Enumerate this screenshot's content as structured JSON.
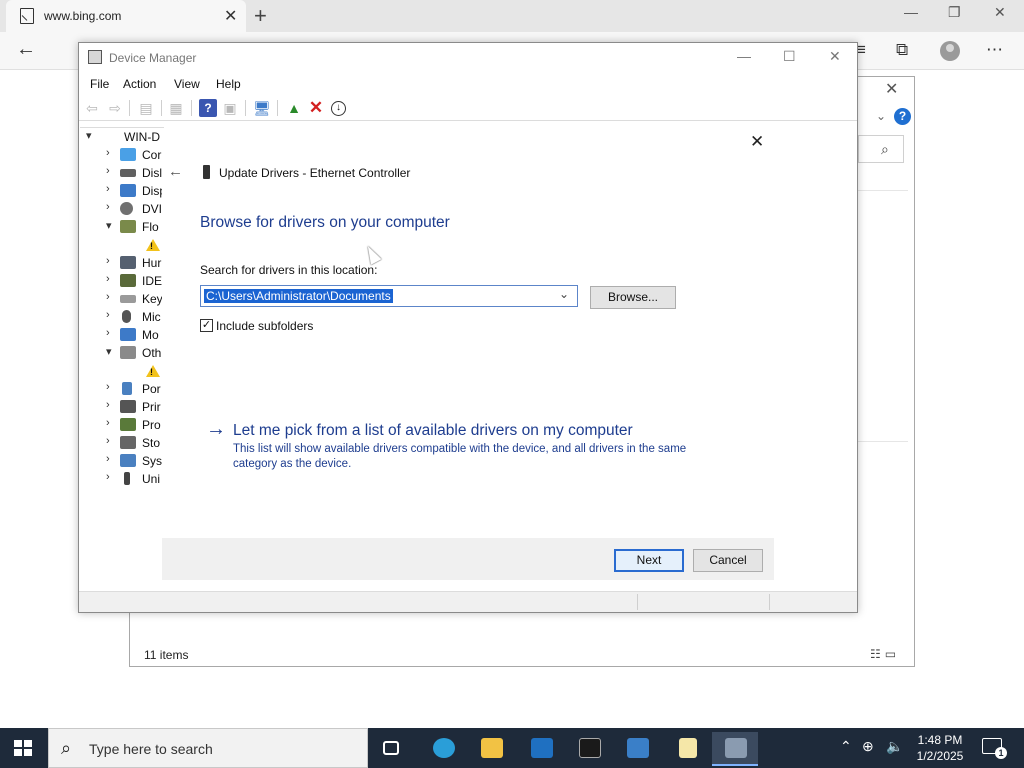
{
  "browser": {
    "tab_title": "www.bing.com",
    "tab_close": "✕",
    "new_tab": "+",
    "minimize": "—",
    "restore": "❐",
    "close": "✕",
    "back": "←",
    "more": "⋯"
  },
  "explorer_bg": {
    "close": "✕",
    "help": "?",
    "item_count": "11 items"
  },
  "device_manager": {
    "title": "Device Manager",
    "menu": [
      "File",
      "Action",
      "View",
      "Help"
    ],
    "tree": [
      {
        "label": "WIN-D",
        "expander": "▾",
        "icon": "computer-icon",
        "color": "#6b7f95"
      },
      {
        "label": "Cor",
        "expander": "›",
        "icon": "computer-icon",
        "color": "#4aa0e6"
      },
      {
        "label": "Disl",
        "expander": "›",
        "icon": "disk-drive-icon",
        "color": "#606060"
      },
      {
        "label": "Disp",
        "expander": "›",
        "icon": "display-adapter-icon",
        "color": "#3d7ac8"
      },
      {
        "label": "DVI",
        "expander": "›",
        "icon": "dvd-drive-icon",
        "color": "#707070"
      },
      {
        "label": "Flo",
        "expander": "▾",
        "icon": "floppy-controller-icon",
        "color": "#7a8a4a"
      },
      {
        "label": "Hur",
        "expander": "›",
        "icon": "hid-icon",
        "color": "#556070"
      },
      {
        "label": "IDE",
        "expander": "›",
        "icon": "ide-controller-icon",
        "color": "#5a6a3a"
      },
      {
        "label": "Key",
        "expander": "›",
        "icon": "keyboard-icon",
        "color": "#7a7a7a"
      },
      {
        "label": "Mic",
        "expander": "›",
        "icon": "mouse-icon",
        "color": "#555555"
      },
      {
        "label": "Mo",
        "expander": "›",
        "icon": "monitor-icon",
        "color": "#3d7ac8"
      },
      {
        "label": "Oth",
        "expander": "▾",
        "icon": "other-devices-icon",
        "color": "#8a8a8a"
      },
      {
        "label": "Por",
        "expander": "›",
        "icon": "ports-icon",
        "color": "#4a80c0"
      },
      {
        "label": "Prir",
        "expander": "›",
        "icon": "print-queue-icon",
        "color": "#555555"
      },
      {
        "label": "Pro",
        "expander": "›",
        "icon": "processor-icon",
        "color": "#5a7a3a"
      },
      {
        "label": "Sto",
        "expander": "›",
        "icon": "storage-controller-icon",
        "color": "#666666"
      },
      {
        "label": "Syst",
        "expander": "›",
        "icon": "system-devices-icon",
        "color": "#4a80c0"
      },
      {
        "label": "Uni",
        "expander": "›",
        "icon": "usb-icon",
        "color": "#444444"
      }
    ]
  },
  "wizard": {
    "close": "✕",
    "back": "←",
    "title": "Update Drivers - Ethernet Controller",
    "heading": "Browse for drivers on your computer",
    "search_label": "Search for drivers in this location:",
    "path_value": "C:\\Users\\Administrator\\Documents",
    "browse_label": "Browse...",
    "include_subfolders_label": "Include subfolders",
    "include_subfolders_checked": true,
    "pick_link": "Let me pick from a list of available drivers on my computer",
    "pick_description": "This list will show available drivers compatible with the device, and all drivers in the same category as the device.",
    "next_label": "Next",
    "cancel_label": "Cancel"
  },
  "taskbar": {
    "search_placeholder": "Type here to search",
    "time": "1:48 PM",
    "date": "1/2/2025",
    "notification_count": "1"
  },
  "colors": {
    "link_blue": "#1e3d8f",
    "selection_blue": "#1b64d2",
    "taskbar_bg": "#1e2a3a"
  }
}
